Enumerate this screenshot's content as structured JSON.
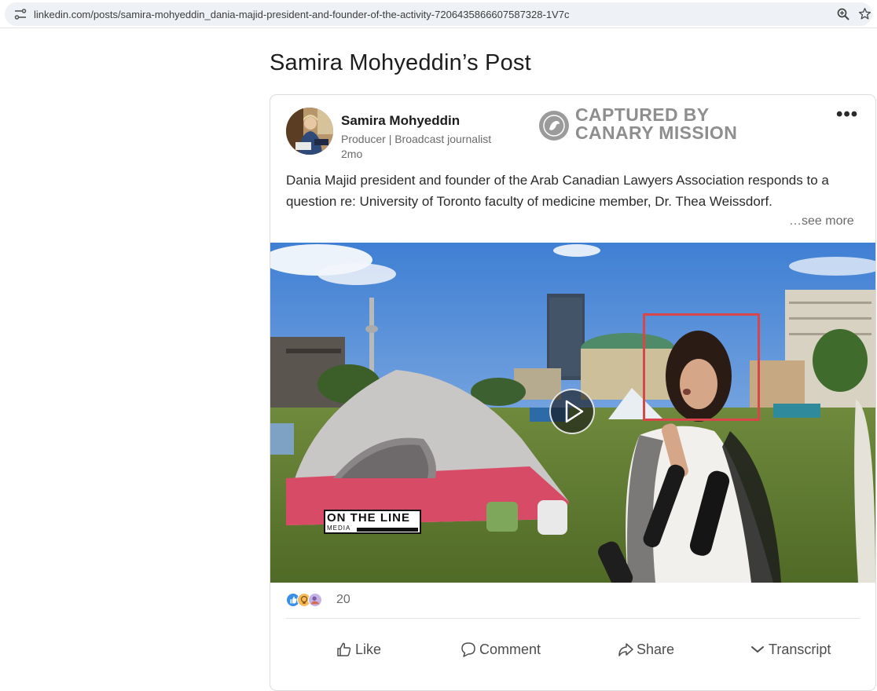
{
  "browser": {
    "url": "linkedin.com/posts/samira-mohyeddin_dania-majid-president-and-founder-of-the-activity-7206435866607587328-1V7c",
    "icons": [
      "site-settings-icon",
      "zoom-icon",
      "bookmark-star-icon"
    ]
  },
  "page": {
    "title": "Samira Mohyeddin’s Post"
  },
  "post": {
    "author_name": "Samira Mohyeddin",
    "author_title": "Producer | Broadcast journalist",
    "time": "2mo",
    "more_label": "•••",
    "text": "Dania Majid president and founder of the Arab Canadian Lawyers Association responds to a question re: University of Toronto faculty of medicine member, Dr. Thea Weissdorf.",
    "see_more": "…see more",
    "watermark_line1": "CAPTURED BY",
    "watermark_line2": "CANARY MISSION",
    "video_logo_main": "ON THE LINE",
    "video_logo_sub": "MEDIA",
    "reactions": {
      "types": [
        "like",
        "insightful",
        "support"
      ],
      "count": "20"
    },
    "actions": {
      "like": "Like",
      "comment": "Comment",
      "share": "Share",
      "transcript": "Transcript"
    }
  },
  "colors": {
    "accent": "#0a66c2",
    "highlight_box": "#d9464a",
    "watermark": "#8e8e8e"
  }
}
